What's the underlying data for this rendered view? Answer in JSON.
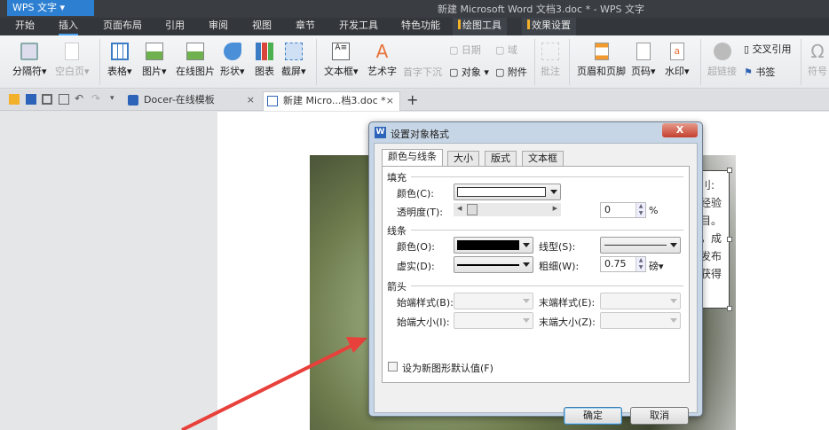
{
  "app": {
    "name": "WPS 文字",
    "window_title": "新建 Microsoft Word 文档3.doc * - WPS 文字"
  },
  "menu": [
    "开始",
    "插入",
    "页面布局",
    "引用",
    "审阅",
    "视图",
    "章节",
    "开发工具",
    "特色功能",
    "绘图工具",
    "效果设置"
  ],
  "ribbon": {
    "large": [
      "分隔符",
      "空白页",
      "表格",
      "图片",
      "在线图片",
      "形状",
      "图表",
      "截屏",
      "文本框",
      "艺术字",
      "批注",
      "页眉和页脚",
      "页码",
      "水印",
      "超链接",
      "符号"
    ],
    "small": [
      "首字下沉",
      "日期",
      "域",
      "对象",
      "附件",
      "交叉引用",
      "书签"
    ]
  },
  "tabs": {
    "docer": "Docer-在线模板",
    "doc": "新建 Micro...档3.doc *",
    "new": "+",
    "close": "×"
  },
  "textbox_lines": [
    "刂:",
    "经验",
    "目。",
    "，成",
    "发布",
    "获得"
  ],
  "dialog": {
    "title": "设置对象格式",
    "close": "X",
    "tabs": [
      "颜色与线条",
      "大小",
      "版式",
      "文本框"
    ],
    "fill": {
      "heading": "填充",
      "color_label": "颜色(C):",
      "transparency_label": "透明度(T):",
      "transparency_value": "0",
      "transparency_unit": "%",
      "transparency_fraction": 0
    },
    "line": {
      "heading": "线条",
      "color_label": "颜色(O):",
      "color_value": "#000000",
      "style_label": "线型(S):",
      "dash_label": "虚实(D):",
      "weight_label": "粗细(W):",
      "weight_value": "0.75",
      "weight_unit": "磅▾"
    },
    "arrows": {
      "heading": "箭头",
      "begin_style": "始端样式(B):",
      "end_style": "末端样式(E):",
      "begin_size": "始端大小(I):",
      "end_size": "末端大小(Z):"
    },
    "default_checkbox": "设为新图形默认值(F)",
    "ok": "确定",
    "cancel": "取消"
  },
  "colors": {
    "accent": "#2d7fd1",
    "arrow": "#e8403a"
  }
}
